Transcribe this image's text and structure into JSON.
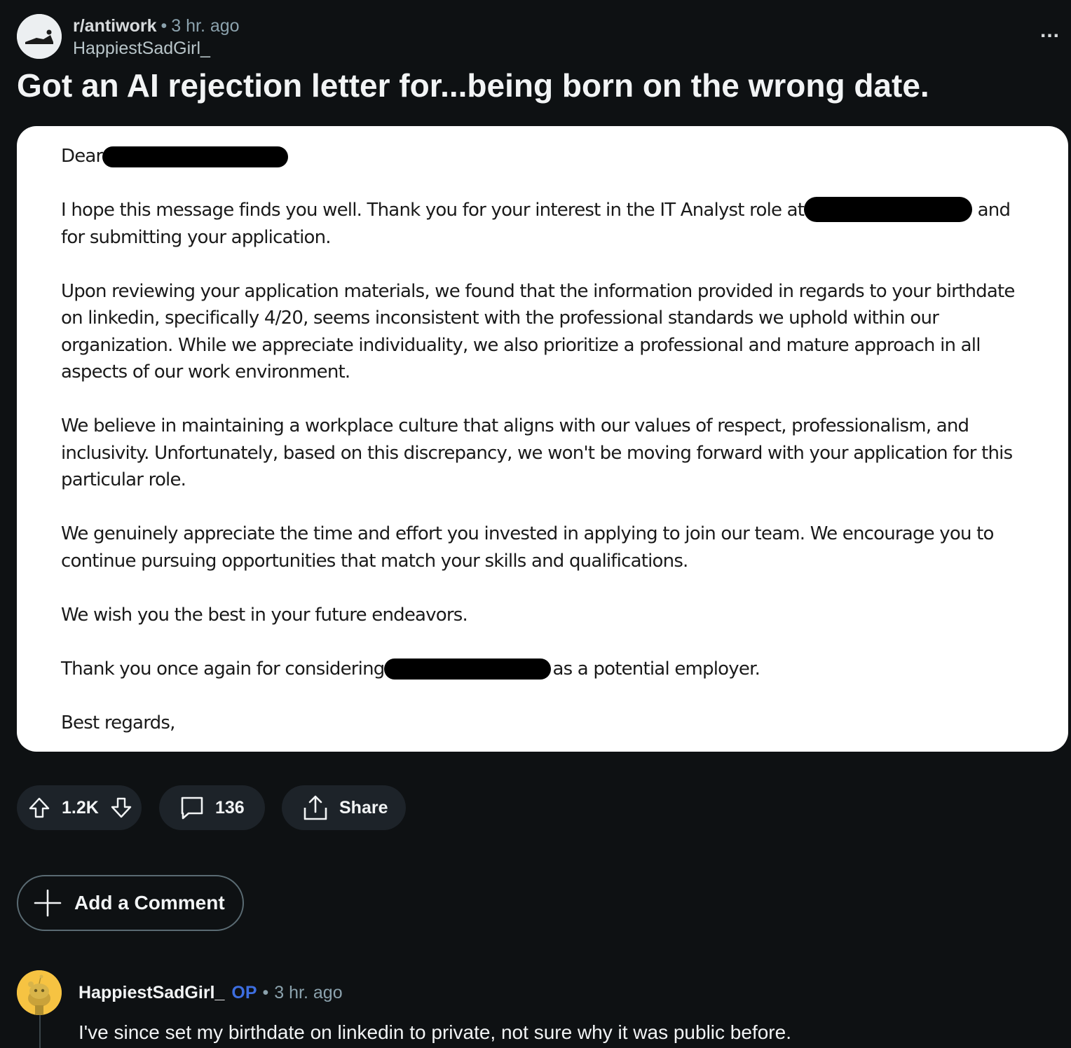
{
  "post": {
    "subreddit": "r/antiwork",
    "separator": "•",
    "time": "3 hr. ago",
    "author": "HappiestSadGirl_",
    "more_label": "...",
    "title": "Got an AI rejection letter for...being born on the wrong date.",
    "avatar_icon": "subreddit-avatar-icon"
  },
  "letter": {
    "greeting": "Dear",
    "p1_a": "I hope this message finds you well. Thank you for your interest in the IT Analyst role at",
    "p1_b": "and for submitting your application.",
    "p2": "Upon reviewing your application materials, we found that the information provided in regards to your birthdate on linkedin, specifically 4/20, seems inconsistent with the professional standards we uphold within our organization. While we appreciate individuality, we also prioritize a professional and mature approach in all aspects of our work environment.",
    "p3": "We believe in maintaining a workplace culture that aligns with our values of respect, professionalism, and inclusivity. Unfortunately, based on this discrepancy, we won't be moving forward with your application for this particular role.",
    "p4": "We genuinely appreciate the time and effort you invested in applying to join our team. We encourage you to continue pursuing opportunities that match your skills and qualifications.",
    "p5": "We wish you the best in your future endeavors.",
    "p6_a": "Thank you once again for considering",
    "p6_b": "as a potential employer.",
    "closing": "Best regards,"
  },
  "actions": {
    "vote_count": "1.2K",
    "comment_count": "136",
    "share_label": "Share",
    "add_comment_label": "Add a Comment"
  },
  "comment": {
    "author": "HappiestSadGirl_",
    "op_badge": "OP",
    "separator": "•",
    "time": "3 hr. ago",
    "body": "I've since set my birthdate on linkedin to private, not sure why it was public before."
  },
  "colors": {
    "background": "#0e1113",
    "pill": "#1d2329",
    "op_badge": "#3d6ee0",
    "comment_avatar": "#f6c342"
  }
}
